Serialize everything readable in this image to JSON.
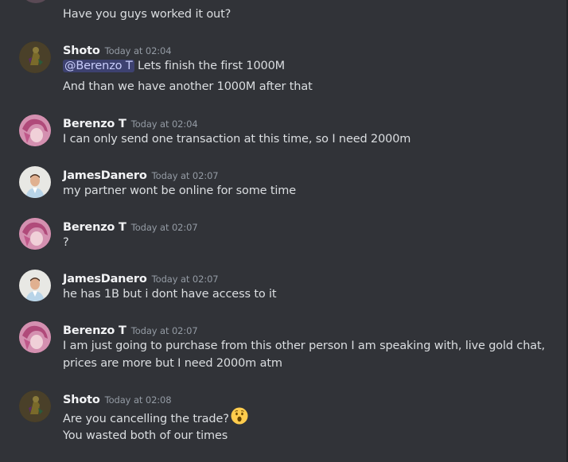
{
  "messages": [
    {
      "lines": [
        "Have you guys worked it out?"
      ]
    },
    {
      "username": "Shoto",
      "timestamp": "Today at 02:04",
      "mention": "@Berenzo T",
      "line1_rest": " Lets finish the first 1000M",
      "lines": [
        "And than we have another 1000M after that"
      ]
    },
    {
      "username": "Berenzo T",
      "timestamp": "Today at 02:04",
      "lines": [
        "I can only send one transaction at this time, so I need 2000m"
      ]
    },
    {
      "username": "JamesDanero",
      "timestamp": "Today at 02:07",
      "lines": [
        "my partner wont be online for some time"
      ]
    },
    {
      "username": "Berenzo T",
      "timestamp": "Today at 02:07",
      "lines": [
        "?"
      ]
    },
    {
      "username": "JamesDanero",
      "timestamp": "Today at 02:07",
      "lines": [
        "he has 1B but i dont have access to it"
      ]
    },
    {
      "username": "Berenzo T",
      "timestamp": "Today at 02:07",
      "lines": [
        "I am just going to purchase from this other person I am speaking with, live gold chat,",
        "prices are more but I need 2000m atm"
      ]
    },
    {
      "username": "Shoto",
      "timestamp": "Today at 02:08",
      "lines": [
        "Are you cancelling the trade?",
        "You wasted both of our times"
      ],
      "emoji": "hushed-face-emoji"
    }
  ],
  "colors": {
    "background": "#313338",
    "username": "#f2f3f5",
    "timestamp": "#949ba4",
    "text": "#dbdee1",
    "mention_bg": "#3c4270",
    "mention_text": "#c9cdfb"
  }
}
